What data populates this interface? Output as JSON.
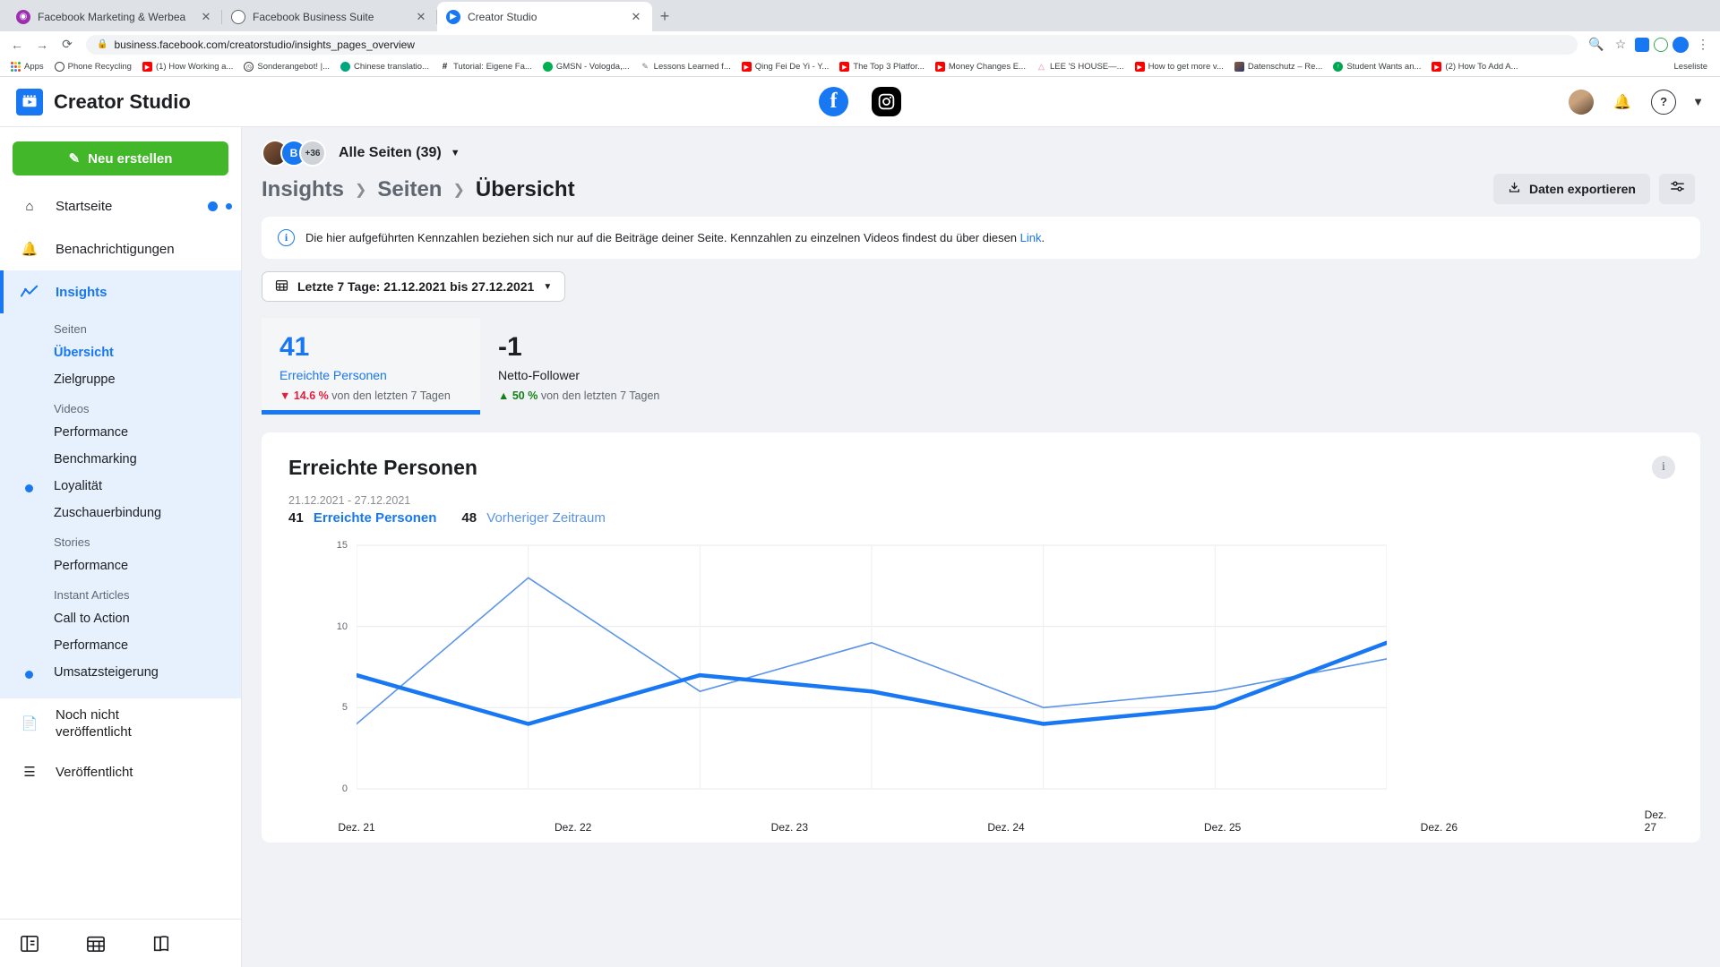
{
  "browser": {
    "tabs": [
      {
        "title": "Facebook Marketing & Werbea",
        "favicon": "instagram-icon",
        "active": false
      },
      {
        "title": "Facebook Business Suite",
        "favicon": "business-suite-icon",
        "active": false
      },
      {
        "title": "Creator Studio",
        "favicon": "creator-studio-icon",
        "active": true
      }
    ],
    "new_tab_label": "+",
    "url": "business.facebook.com/creatorstudio/insights_pages_overview",
    "nav": {
      "back": "←",
      "forward": "→",
      "reload": "⟳"
    },
    "bookmarks": [
      {
        "label": "Apps",
        "icon": "apps-grid-icon"
      },
      {
        "label": "Phone Recycling",
        "icon": "circle-icon"
      },
      {
        "label": "(1) How Working a...",
        "icon": "youtube-icon"
      },
      {
        "label": "Sonderangebot! |...",
        "icon": "clock-icon"
      },
      {
        "label": "Chinese translatio...",
        "icon": "green-circle-icon"
      },
      {
        "label": "Tutorial: Eigene Fa...",
        "icon": "hash-icon"
      },
      {
        "label": "GMSN - Vologda,...",
        "icon": "green-circle-icon"
      },
      {
        "label": "Lessons Learned f...",
        "icon": "pen-icon"
      },
      {
        "label": "Qing Fei De Yi - Y...",
        "icon": "youtube-icon"
      },
      {
        "label": "The Top 3 Platfor...",
        "icon": "youtube-icon"
      },
      {
        "label": "Money Changes E...",
        "icon": "youtube-icon"
      },
      {
        "label": "LEE 'S HOUSE—...",
        "icon": "pink-a-icon"
      },
      {
        "label": "How to get more v...",
        "icon": "youtube-icon"
      },
      {
        "label": "Datenschutz – Re...",
        "icon": "photo-icon"
      },
      {
        "label": "Student Wants an...",
        "icon": "green-arrow-icon"
      },
      {
        "label": "(2) How To Add A...",
        "icon": "youtube-icon"
      }
    ],
    "bookmarks_right_label": "Leseliste"
  },
  "app_header": {
    "title": "Creator Studio",
    "logo_icon": "creator-studio-logo",
    "facebook_tab_icon": "facebook-icon",
    "instagram_tab_icon": "instagram-icon",
    "avatar_icon": "user-avatar",
    "bell_icon": "bell-icon",
    "help_icon": "help-icon",
    "caret_icon": "chevron-down-icon"
  },
  "sidebar": {
    "create_button": "Neu erstellen",
    "create_icon": "pencil-square-icon",
    "items": [
      {
        "label": "Startseite",
        "icon": "home-icon",
        "active": false,
        "badge": true
      },
      {
        "label": "Benachrichtigungen",
        "icon": "bell-icon",
        "active": false
      },
      {
        "label": "Insights",
        "icon": "insights-chart-icon",
        "active": true
      }
    ],
    "insights_groups": [
      {
        "heading": "Seiten",
        "items": [
          {
            "label": "Übersicht",
            "selected": true
          },
          {
            "label": "Zielgruppe",
            "selected": false
          }
        ]
      },
      {
        "heading": "Videos",
        "items": [
          {
            "label": "Performance",
            "selected": false
          },
          {
            "label": "Benchmarking",
            "selected": false
          },
          {
            "label": "Loyalität",
            "selected": false,
            "dot": true
          },
          {
            "label": "Zuschauerbindung",
            "selected": false
          }
        ]
      },
      {
        "heading": "Stories",
        "items": [
          {
            "label": "Performance",
            "selected": false
          }
        ]
      },
      {
        "heading": "Instant Articles",
        "items": [
          {
            "label": "Call to Action",
            "selected": false
          },
          {
            "label": "Performance",
            "selected": false
          },
          {
            "label": "Umsatzsteigerung",
            "selected": false,
            "dot": true
          }
        ]
      }
    ],
    "lower_items": [
      {
        "label": "Noch nicht veröffentlicht",
        "icon": "document-icon"
      },
      {
        "label": "Veröffentlicht",
        "icon": "list-icon"
      }
    ],
    "footer_icons": [
      "panel-collapse-icon",
      "calendar-icon",
      "book-icon"
    ]
  },
  "content": {
    "pages_selector": {
      "label": "Alle Seiten (39)",
      "caret_icon": "chevron-down-icon",
      "avatar_overflow": "+36",
      "avatar_initial": "B"
    },
    "export_button": {
      "label": "Daten exportieren",
      "icon": "download-icon"
    },
    "settings_button_icon": "settings-sliders-icon",
    "breadcrumb": [
      {
        "label": "Insights",
        "last": false
      },
      {
        "label": "Seiten",
        "last": false
      },
      {
        "label": "Übersicht",
        "last": true
      }
    ],
    "notice": {
      "icon": "info-icon",
      "text": "Die hier aufgeführten Kennzahlen beziehen sich nur auf die Beiträge deiner Seite. Kennzahlen zu einzelnen Videos findest du über diesen ",
      "link": "Link",
      "text_after": "."
    },
    "date_range": {
      "icon": "calendar-icon",
      "label": "Letzte 7 Tage: 21.12.2021 bis 27.12.2021",
      "caret_icon": "chevron-down-icon"
    },
    "kpis": [
      {
        "value": "41",
        "label": "Erreichte Personen",
        "delta": "14.6 %",
        "delta_direction": "down",
        "delta_arrow": "▼",
        "delta_suffix": "von den letzten 7 Tagen",
        "selected": true
      },
      {
        "value": "-1",
        "label": "Netto-Follower",
        "delta": "50 %",
        "delta_direction": "up",
        "delta_arrow": "▲",
        "delta_suffix": "von den letzten 7 Tagen",
        "selected": false
      }
    ],
    "chart_card": {
      "title": "Erreichte Personen",
      "date_sub": "21.12.2021 - 27.12.2021",
      "legend": [
        {
          "value": "41",
          "label": "Erreichte Personen"
        },
        {
          "value": "48",
          "label": "Vorheriger Zeitraum"
        }
      ],
      "info_icon": "info-icon"
    }
  },
  "colors": {
    "brand_blue": "#1877f2",
    "green": "#42b72a",
    "red": "#e41e3f",
    "prev_period_line": "#5a93e8",
    "page_bg": "#f0f2f5"
  },
  "chart_data": {
    "type": "line",
    "title": "Erreichte Personen",
    "xlabel": "",
    "ylabel": "",
    "ylim": [
      0,
      15
    ],
    "yticks": [
      0,
      5,
      10,
      15
    ],
    "grid": true,
    "legend_position": "top-left",
    "categories": [
      "Dez. 21",
      "Dez. 22",
      "Dez. 23",
      "Dez. 24",
      "Dez. 25",
      "Dez. 26",
      "Dez. 27"
    ],
    "series": [
      {
        "name": "Erreichte Personen",
        "color": "#1877f2",
        "width": "thick",
        "total": 41,
        "values": [
          7,
          4,
          7,
          6,
          4,
          5,
          9
        ]
      },
      {
        "name": "Vorheriger Zeitraum",
        "color": "#5a93e8",
        "width": "thin",
        "total": 48,
        "values": [
          4,
          13,
          6,
          9,
          5,
          6,
          8
        ]
      }
    ]
  }
}
